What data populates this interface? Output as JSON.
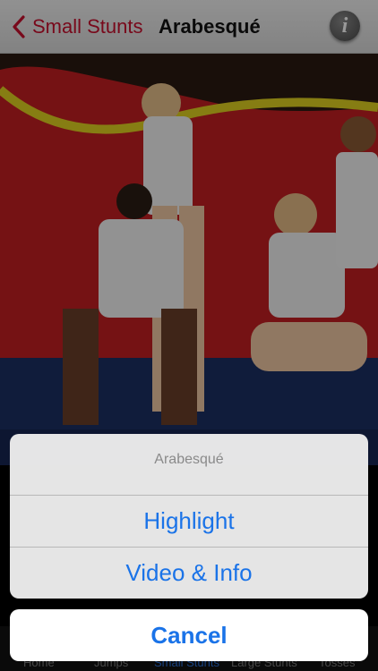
{
  "nav": {
    "back_label": "Small Stunts",
    "title": "Arabesqué",
    "info_label": "i"
  },
  "tabs": [
    {
      "label": "Home"
    },
    {
      "label": "Jumps"
    },
    {
      "label": "Small Stunts"
    },
    {
      "label": "Large Stunts"
    },
    {
      "label": "Tosses"
    }
  ],
  "action_sheet": {
    "title": "Arabesqué",
    "options": [
      "Highlight",
      "Video & Info"
    ],
    "cancel": "Cancel"
  },
  "colors": {
    "accent_red": "#c8102e",
    "ios_blue": "#1a73e8"
  }
}
